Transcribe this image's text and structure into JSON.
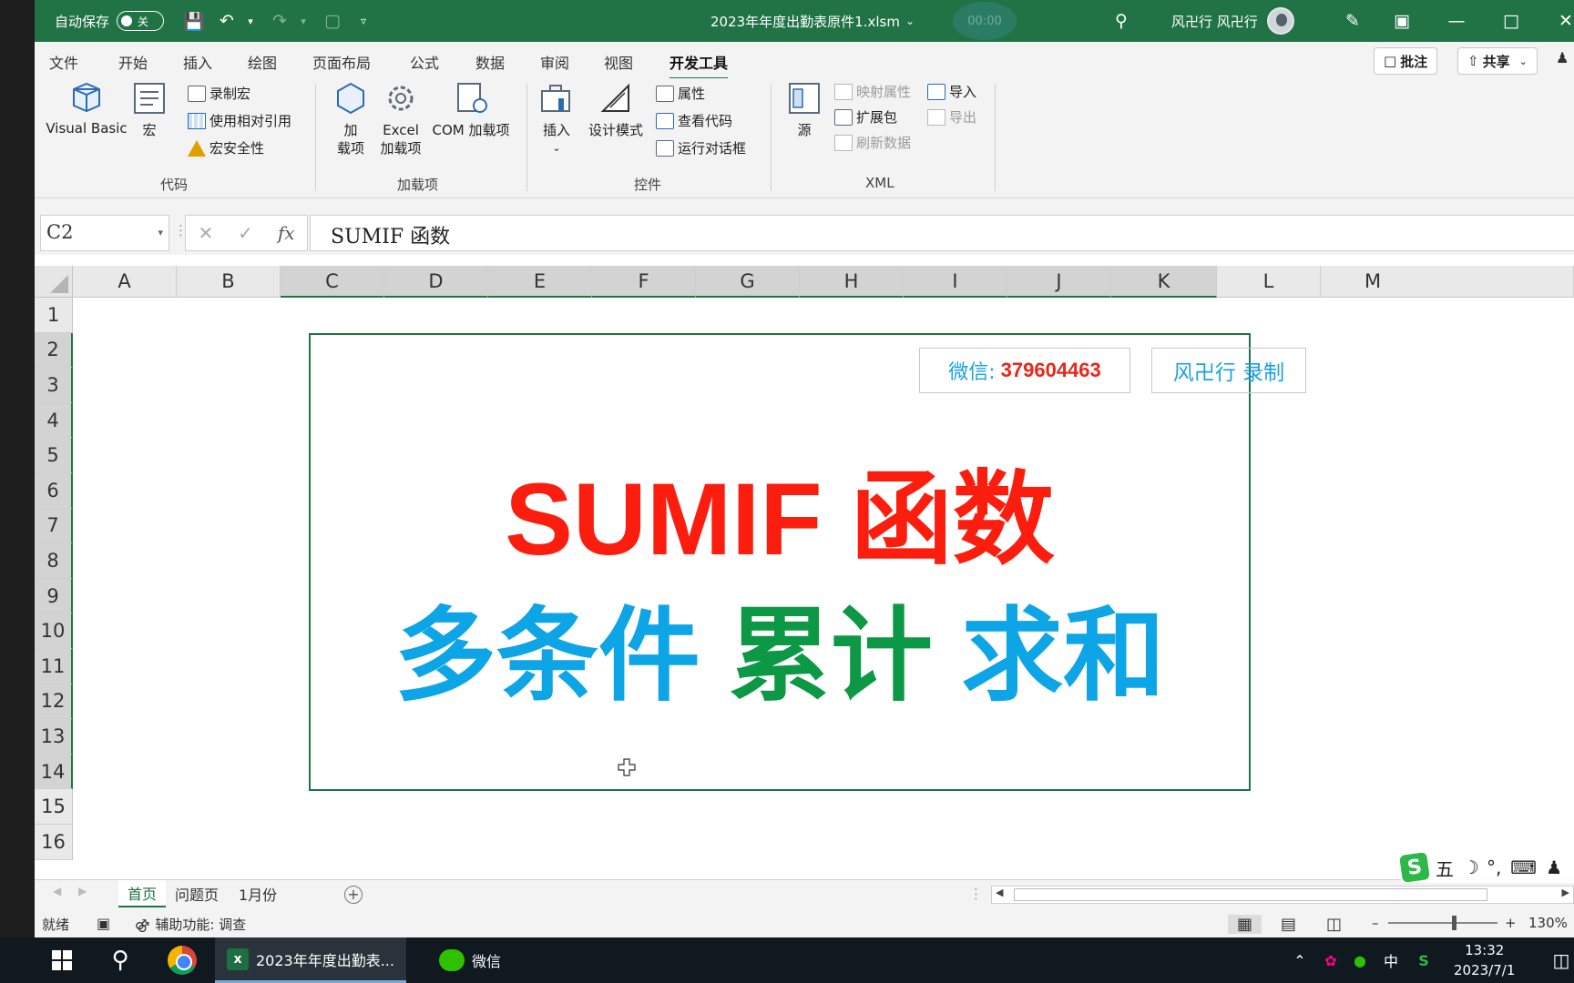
{
  "titlebar": {
    "autosave_label": "自动保存",
    "autosave_state": "关",
    "file_title": "2023年年度出勤表原件1.xlsm",
    "timer": "00:00",
    "user_name": "风卍行 风卍行"
  },
  "tabs": [
    "文件",
    "开始",
    "插入",
    "绘图",
    "页面布局",
    "公式",
    "数据",
    "审阅",
    "视图",
    "开发工具"
  ],
  "tab_buttons": {
    "comments": "批注",
    "share": "共享"
  },
  "ribbon": {
    "code": {
      "visual_basic": "Visual Basic",
      "macros": "宏",
      "record_macro": "录制宏",
      "relative_ref": "使用相对引用",
      "macro_security": "宏安全性",
      "group_label": "代码"
    },
    "addins": {
      "addins_line1": "加",
      "addins_line2": "载项",
      "excel_line1": "Excel",
      "excel_line2": "加载项",
      "com_addins": "COM 加载项",
      "group_label": "加载项"
    },
    "controls": {
      "insert": "插入",
      "design_mode": "设计模式",
      "properties": "属性",
      "view_code": "查看代码",
      "run_dialog": "运行对话框",
      "group_label": "控件"
    },
    "xml": {
      "source": "源",
      "map_properties": "映射属性",
      "expansion_packs": "扩展包",
      "refresh_data": "刷新数据",
      "import": "导入",
      "export": "导出",
      "group_label": "XML"
    }
  },
  "formula_bar": {
    "name_box": "C2",
    "formula": "SUMIF 函数"
  },
  "grid": {
    "columns": [
      "A",
      "B",
      "C",
      "D",
      "E",
      "F",
      "G",
      "H",
      "I",
      "J",
      "K",
      "L",
      "M"
    ],
    "rows": [
      "1",
      "2",
      "3",
      "4",
      "5",
      "6",
      "7",
      "8",
      "9",
      "10",
      "11",
      "12",
      "13",
      "14",
      "15",
      "16"
    ]
  },
  "canvas": {
    "wechat_label": "微信:",
    "wechat_number": "379604463",
    "recorder": "风卍行 录制",
    "title": "SUMIF 函数",
    "subtitle_part1": "多条件",
    "subtitle_part2": "累计",
    "subtitle_part3": "求和"
  },
  "sheets": [
    "首页",
    "问题页",
    "1月份"
  ],
  "statusbar": {
    "ready": "就绪",
    "accessibility": "辅助功能: 调查",
    "zoom": "130%"
  },
  "ime": {
    "mode": "五"
  },
  "taskbar": {
    "excel_app": "2023年年度出勤表...",
    "wechat_app": "微信",
    "lang": "中",
    "time": "13:32",
    "date": "2023/7/1"
  },
  "colors": {
    "excel_green": "#217346",
    "title_red": "#fb1e0f",
    "subtitle_blue": "#0ea5e6",
    "subtitle_green": "#0c9845",
    "wechat_num_red": "#e8261b"
  }
}
